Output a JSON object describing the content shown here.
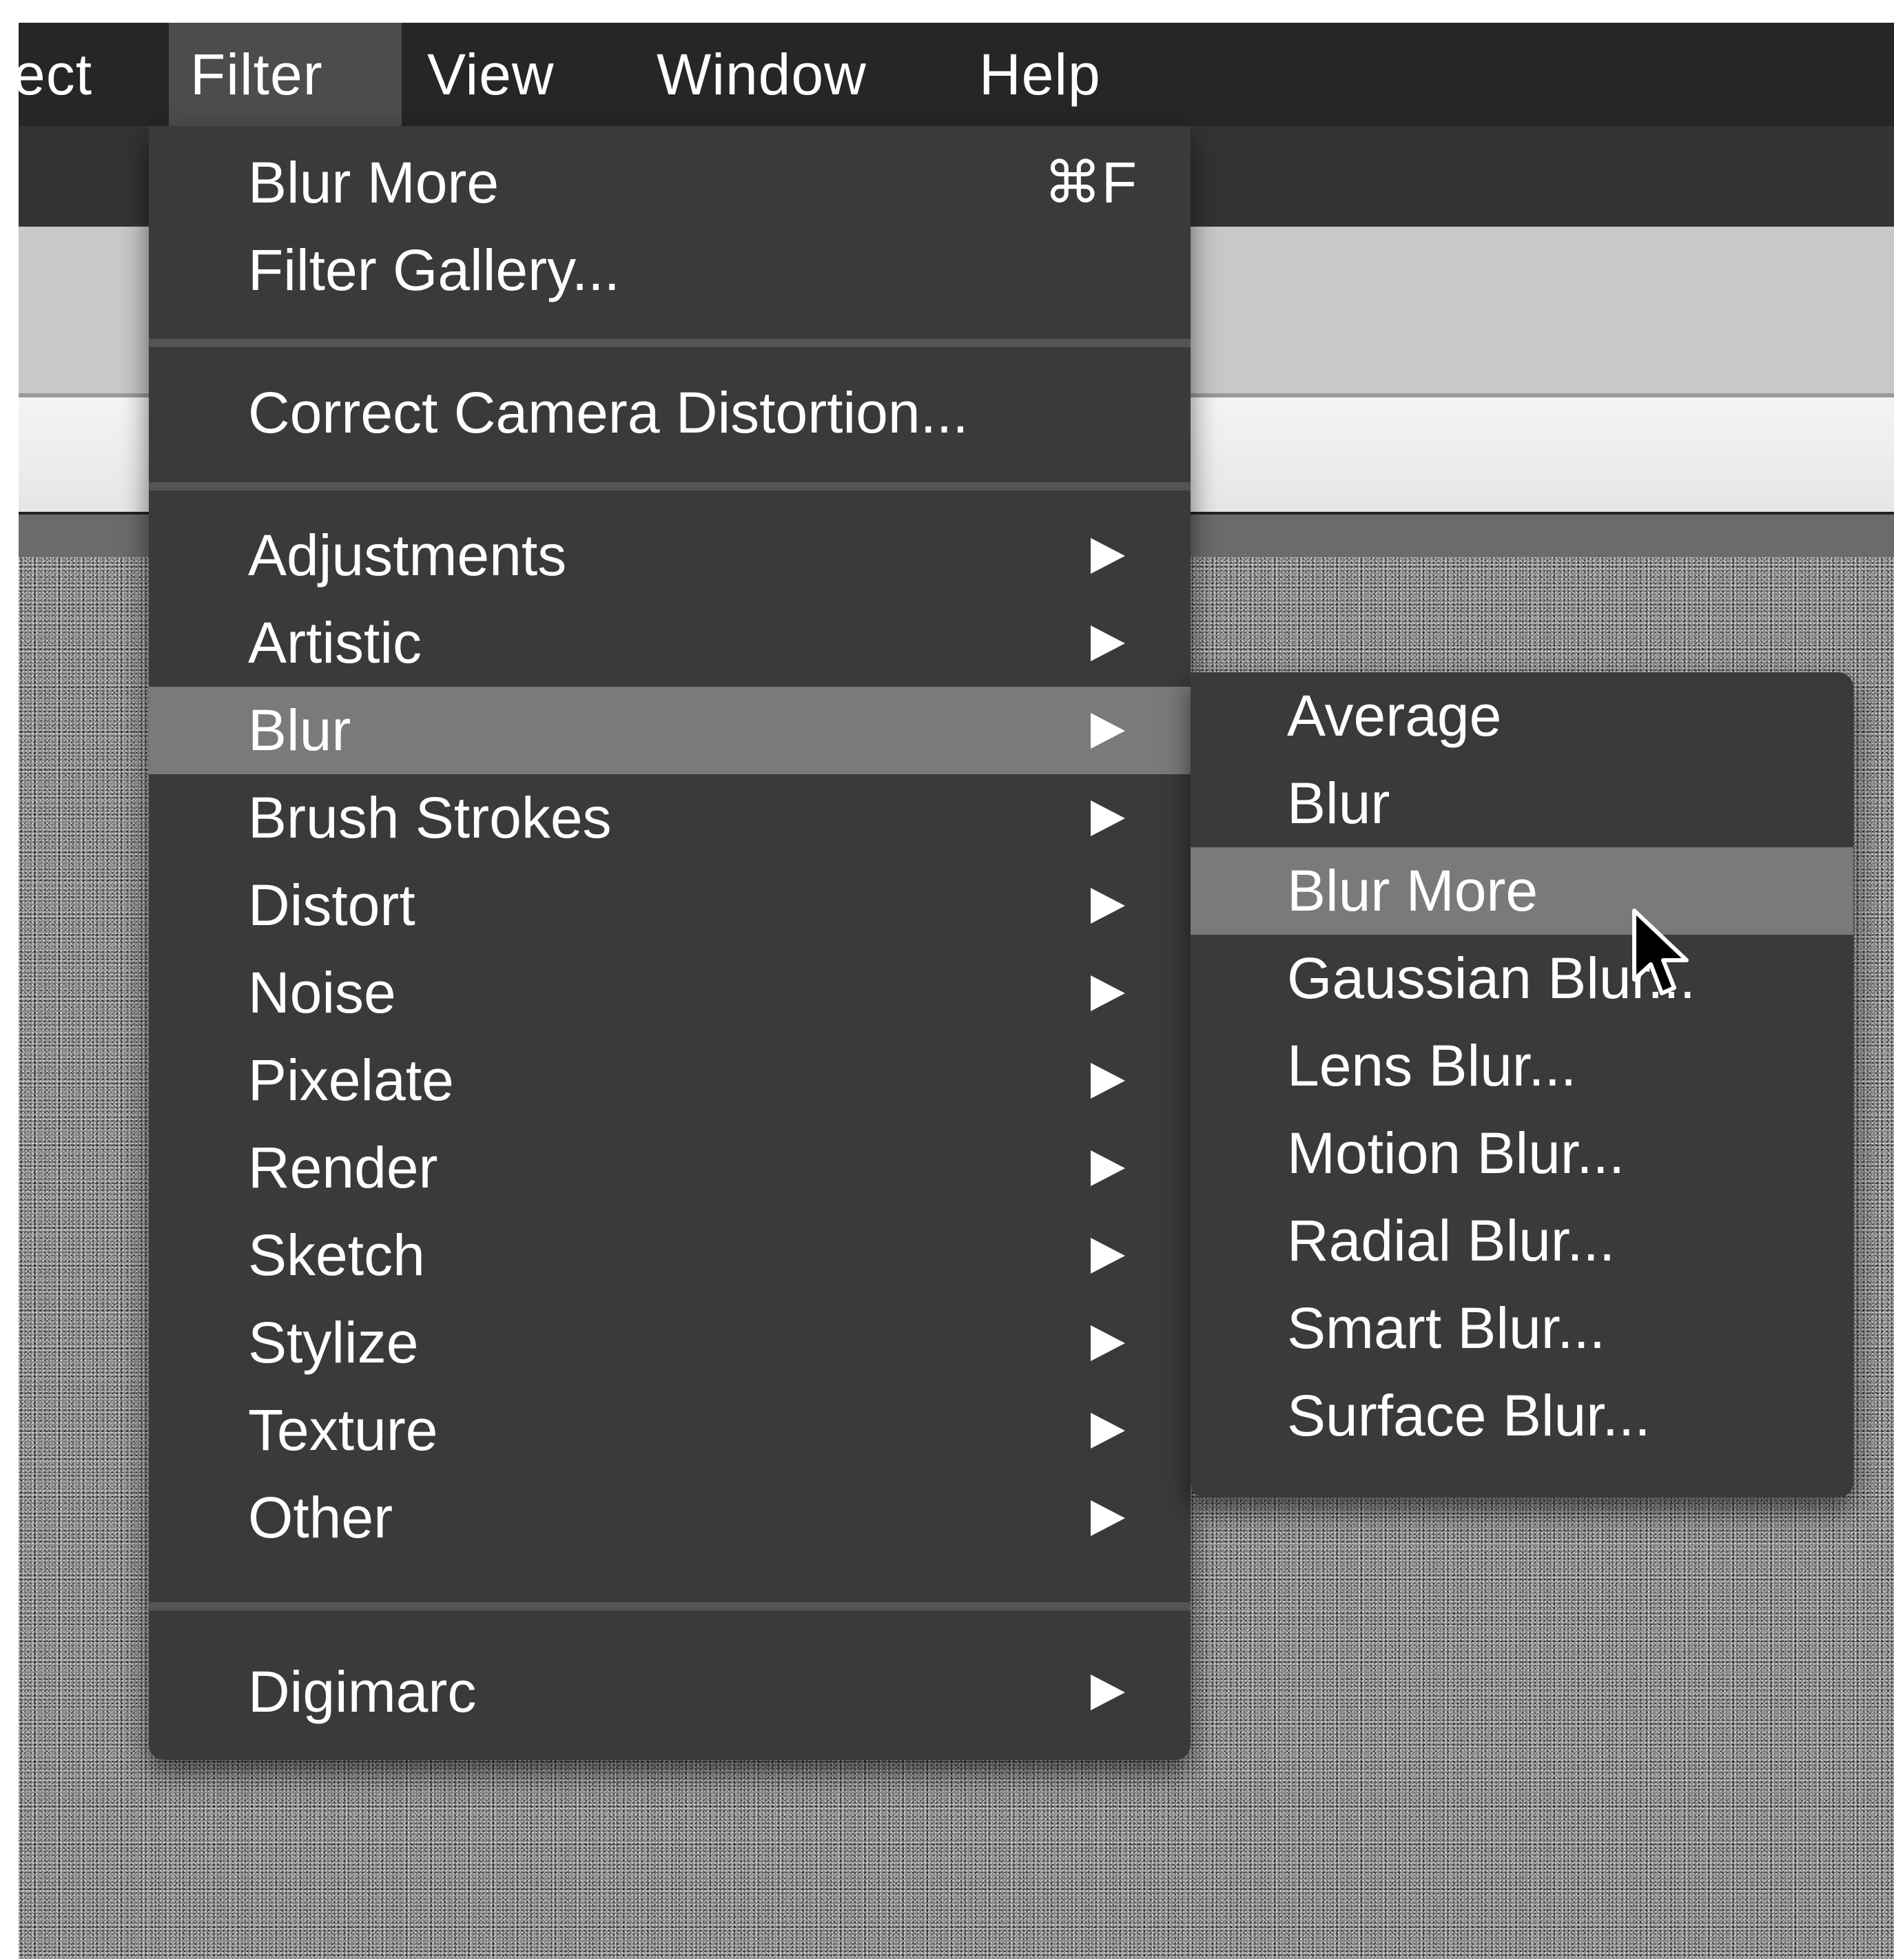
{
  "menubar": {
    "items": [
      {
        "label": "ect"
      },
      {
        "label": "Filter",
        "active": true
      },
      {
        "label": "View"
      },
      {
        "label": "Window"
      },
      {
        "label": "Help"
      }
    ]
  },
  "filter_menu": {
    "items": [
      {
        "label": "Blur More",
        "shortcut": "⌘F"
      },
      {
        "label": "Filter Gallery..."
      },
      {
        "label": "Correct Camera Distortion..."
      },
      {
        "label": "Adjustments",
        "submenu": true
      },
      {
        "label": "Artistic",
        "submenu": true
      },
      {
        "label": "Blur",
        "submenu": true,
        "highlighted": true
      },
      {
        "label": "Brush Strokes",
        "submenu": true
      },
      {
        "label": "Distort",
        "submenu": true
      },
      {
        "label": "Noise",
        "submenu": true
      },
      {
        "label": "Pixelate",
        "submenu": true
      },
      {
        "label": "Render",
        "submenu": true
      },
      {
        "label": "Sketch",
        "submenu": true
      },
      {
        "label": "Stylize",
        "submenu": true
      },
      {
        "label": "Texture",
        "submenu": true
      },
      {
        "label": "Other",
        "submenu": true
      },
      {
        "label": "Digimarc",
        "submenu": true
      }
    ]
  },
  "blur_submenu": {
    "items": [
      {
        "label": "Average"
      },
      {
        "label": "Blur"
      },
      {
        "label": "Blur More",
        "highlighted": true
      },
      {
        "label": "Gaussian Blur..."
      },
      {
        "label": "Lens Blur..."
      },
      {
        "label": "Motion Blur..."
      },
      {
        "label": "Radial Blur..."
      },
      {
        "label": "Smart Blur..."
      },
      {
        "label": "Surface Blur..."
      }
    ]
  },
  "icons": {
    "submenu_arrow": "submenu-arrow-icon",
    "cursor": "mouse-pointer-icon"
  },
  "colors": {
    "menubar_bg": "#262626",
    "menu_bg": "#3a3a3a",
    "highlight": "#7a7a7a",
    "separator": "#545454",
    "text": "#ffffff"
  }
}
